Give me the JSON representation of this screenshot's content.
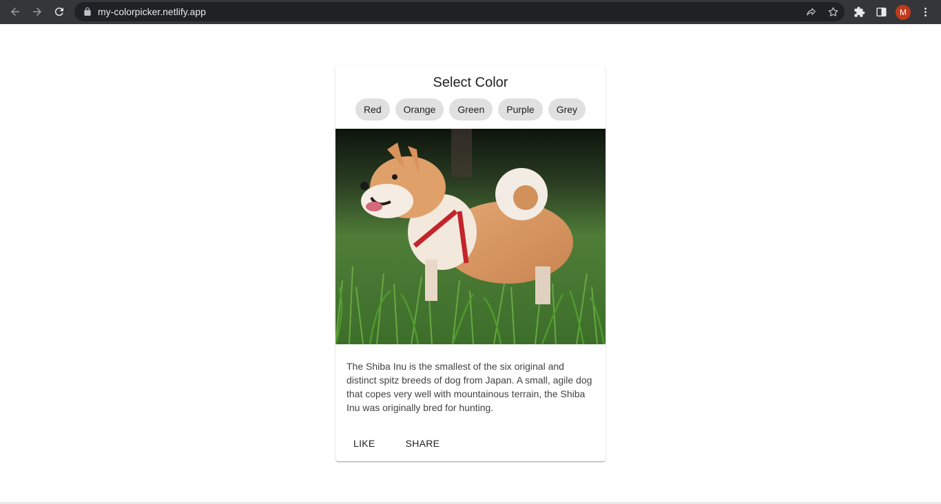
{
  "browser": {
    "url": "my-colorpicker.netlify.app",
    "profile_initial": "M",
    "icons": [
      "back-arrow-icon",
      "forward-arrow-icon",
      "reload-icon",
      "lock-icon",
      "share-icon",
      "star-icon",
      "extensions-icon",
      "side-panel-icon",
      "kebab-menu-icon"
    ]
  },
  "card": {
    "title": "Select Color",
    "chips": [
      {
        "label": "Red"
      },
      {
        "label": "Orange"
      },
      {
        "label": "Green"
      },
      {
        "label": "Purple"
      },
      {
        "label": "Grey"
      }
    ],
    "description": "The Shiba Inu is the smallest of the six original and distinct spitz breeds of dog from Japan. A small, agile dog that copes very well with mountainous terrain, the Shiba Inu was originally bred for hunting.",
    "actions": {
      "like_label": "LIKE",
      "share_label": "SHARE"
    }
  },
  "colors": {
    "browser_bar": "#35363a",
    "omnibox": "#202124",
    "chip_bg": "#e0e0e0",
    "avatar": "#c0391b"
  }
}
